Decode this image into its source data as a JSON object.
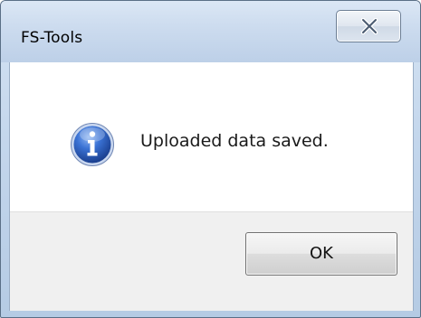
{
  "window": {
    "title": "FS-Tools"
  },
  "dialog": {
    "message": "Uploaded data saved.",
    "icon": "information-icon",
    "ok_label": "OK",
    "close_icon": "close-icon"
  },
  "colors": {
    "info_icon_blue": "#2a5fc1",
    "titlebar": "#cddcef",
    "button_area": "#f0f0f0"
  }
}
